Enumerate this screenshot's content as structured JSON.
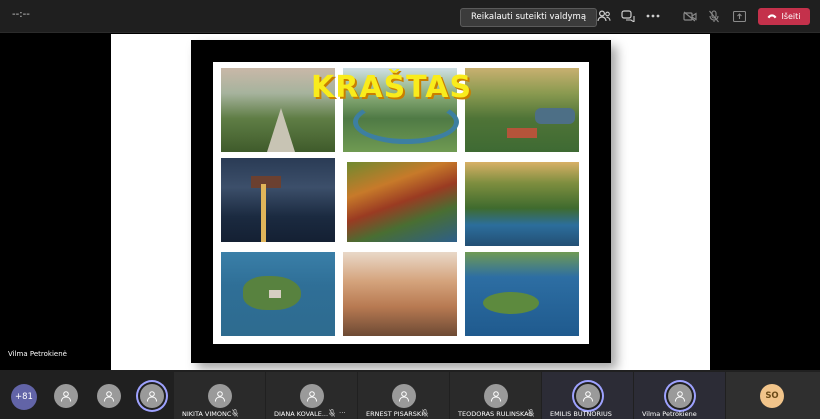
{
  "top_bar": {
    "timer": "--:--",
    "request_control_label": "Reikalauti suteikti valdymą",
    "leave_label": "Išeiti"
  },
  "slide": {
    "title": "KRAŠTAS"
  },
  "presenter_name": "Vilma Petrokienė",
  "participants": {
    "more_count": "+81",
    "tiles": [
      {
        "name": "NIKITA VIMONC"
      },
      {
        "name": "DIANA KOVALE..."
      },
      {
        "name": "ERNEST PISARSKI"
      },
      {
        "name": "TEODORAS RULINSKAS"
      },
      {
        "name": "EMILIS BUTNORIUS"
      },
      {
        "name": "Vilma Petrokiene"
      }
    ],
    "so_initials": "SO"
  },
  "colors": {
    "accent": "#6264a7",
    "leave_red": "#c4314b",
    "title_yellow": "#f9ec1c"
  }
}
